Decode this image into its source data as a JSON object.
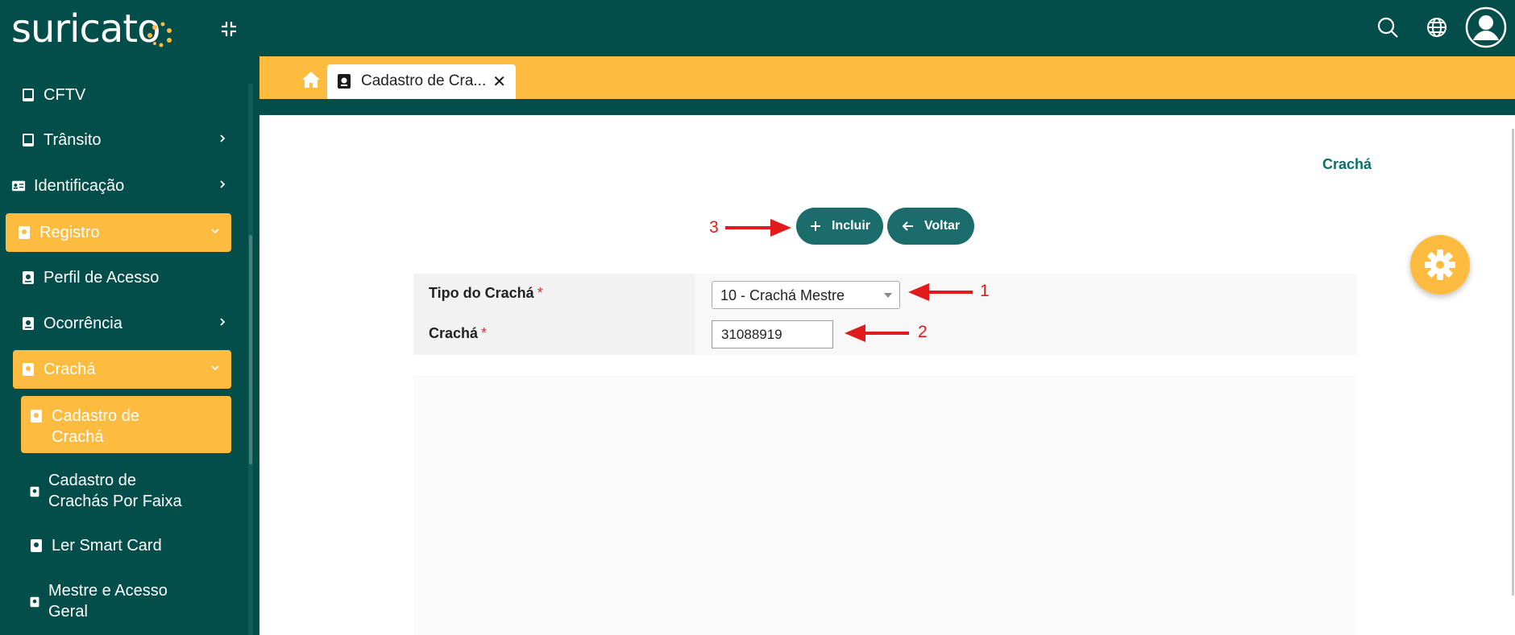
{
  "app": {
    "logo_text": "suricato"
  },
  "sidebar": {
    "items": [
      {
        "label": "CFTV"
      },
      {
        "label": "Trânsito"
      },
      {
        "label": "Identificação"
      },
      {
        "label": "Registro"
      },
      {
        "label": "Perfil de Acesso"
      },
      {
        "label": "Ocorrência"
      },
      {
        "label": "Crachá"
      },
      {
        "label": "Cadastro de Crachá"
      },
      {
        "label": "Cadastro de Crachás Por Faixa"
      },
      {
        "label": "Ler Smart Card"
      },
      {
        "label": "Mestre e Acesso Geral"
      }
    ]
  },
  "tabs": [
    {
      "label": "Cadastro de Cra..."
    }
  ],
  "page": {
    "title": "Crachá"
  },
  "toolbar": {
    "include_label": "Incluir",
    "back_label": "Voltar"
  },
  "form": {
    "tipo_label": "Tipo do Crachá",
    "tipo_value": "10 - Crachá Mestre",
    "cracha_label": "Crachá",
    "cracha_value": "31088919",
    "required_mark": "*"
  },
  "annotations": {
    "n1": "1",
    "n2": "2",
    "n3": "3"
  },
  "colors": {
    "primary": "#034d4a",
    "accent": "#fdbb3f",
    "button": "#1b6d6b",
    "annotation": "#e01b1b"
  },
  "icons": [
    "compress-icon",
    "search-icon",
    "globe-icon",
    "user-avatar-icon",
    "home-icon",
    "badge-icon",
    "gear-icon"
  ]
}
